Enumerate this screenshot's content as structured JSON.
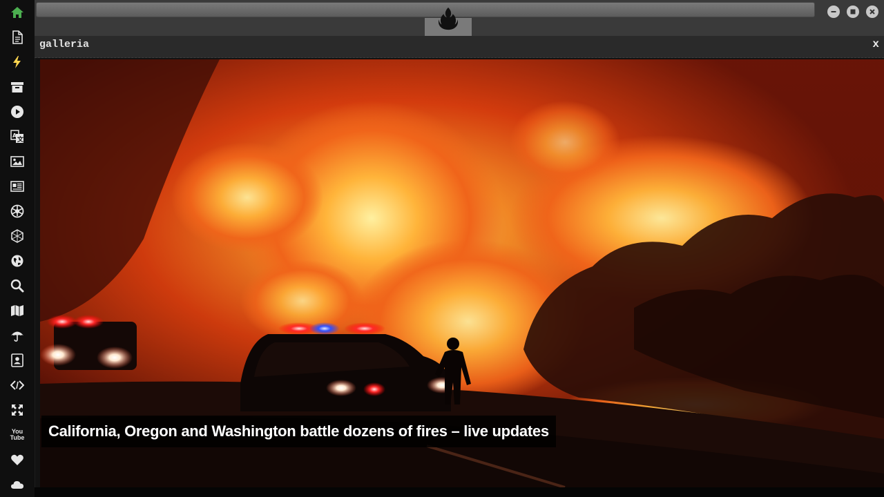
{
  "sidebar": {
    "items": [
      {
        "name": "home-icon",
        "active": true
      },
      {
        "name": "document-icon"
      },
      {
        "name": "lightning-icon"
      },
      {
        "name": "archive-icon"
      },
      {
        "name": "play-icon"
      },
      {
        "name": "translate-icon"
      },
      {
        "name": "image-icon"
      },
      {
        "name": "newspaper-icon"
      },
      {
        "name": "empire-icon"
      },
      {
        "name": "hexagon-network-icon"
      },
      {
        "name": "globe-icon"
      },
      {
        "name": "search-icon"
      },
      {
        "name": "map-icon"
      },
      {
        "name": "umbrella-icon"
      },
      {
        "name": "contact-card-icon"
      },
      {
        "name": "code-icon"
      },
      {
        "name": "expand-icon"
      },
      {
        "name": "youtube-icon",
        "label": "You Tube"
      },
      {
        "name": "heart-icon"
      },
      {
        "name": "cloud-icon"
      }
    ],
    "active_color": "#4caf50",
    "accent_color": "#ffd54f"
  },
  "topbar": {
    "logo_icon": "rebel-alliance-icon",
    "window_controls": [
      "minimize-icon",
      "maximize-icon",
      "close-icon"
    ]
  },
  "panel": {
    "title": "galleria",
    "close_label": "x"
  },
  "gallery": {
    "image_subject": "wildfire-night-scene",
    "caption": "California, Oregon and Washington battle dozens of fires – live updates"
  }
}
